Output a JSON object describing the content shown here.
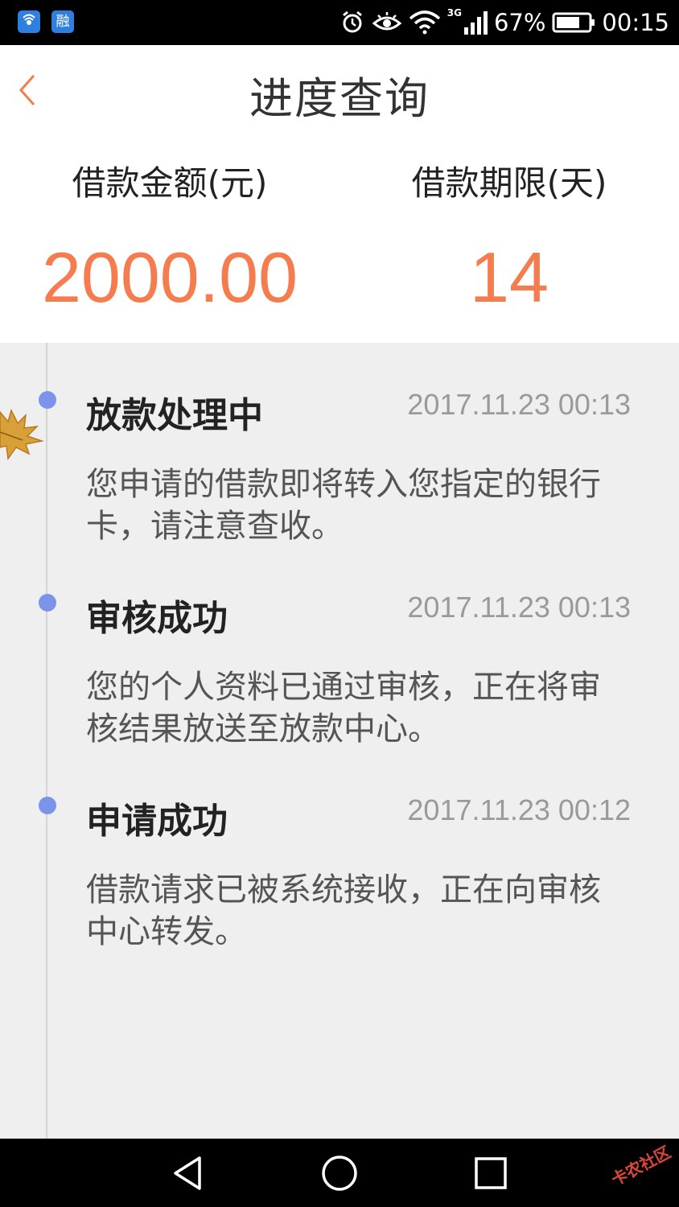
{
  "status_bar": {
    "app_icon_1": "wifi-tool",
    "app_icon_2": "融",
    "network_type": "3G",
    "battery_percent": "67%",
    "time": "00:15"
  },
  "header": {
    "title": "进度查询",
    "amount_label": "借款金额(元)",
    "amount_value": "2000.00",
    "term_label": "借款期限(天)",
    "term_value": "14"
  },
  "timeline": {
    "items": [
      {
        "title": "放款处理中",
        "time": "2017.11.23 00:13",
        "description": "您申请的借款即将转入您指定的银行卡，请注意查收。"
      },
      {
        "title": "审核成功",
        "time": "2017.11.23 00:13",
        "description": "您的个人资料已通过审核，正在将审核结果放送至放款中心。"
      },
      {
        "title": "申请成功",
        "time": "2017.11.23 00:12",
        "description": "借款请求已被系统接收，正在向审核中心转发。"
      }
    ]
  },
  "watermark": "卡农社区",
  "colors": {
    "accent": "#f47c4e",
    "timeline_dot": "#7b93e8",
    "background": "#efefef"
  }
}
